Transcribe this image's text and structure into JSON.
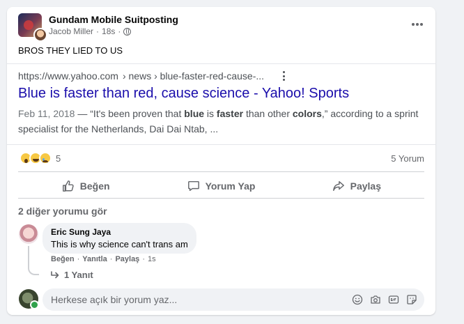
{
  "post": {
    "group_name": "Gundam Mobile Suitposting",
    "author": "Jacob Miller",
    "time": "18s",
    "text": "BROS THEY LIED TO US"
  },
  "link_preview": {
    "url_domain": "https://www.yahoo.com",
    "url_path": "› news › blue-faster-red-cause-...",
    "title": "Blue is faster than red, cause science - Yahoo! Sports",
    "date": "Feb 11, 2018",
    "snippet_parts": [
      "— “It's been proven that ",
      "blue",
      " is ",
      "faster",
      " than other ",
      "colors",
      ",” according to a sprint specialist for the Netherlands, Dai Dai Ntab, ..."
    ]
  },
  "reactions": {
    "icons": [
      "wow-emoji",
      "haha-emoji",
      "sad-emoji"
    ],
    "count": "5",
    "comments": "5 Yorum"
  },
  "actions": {
    "like": "Beğen",
    "comment": "Yorum Yap",
    "share": "Paylaş"
  },
  "comments": {
    "more": "2 diğer yorumu gör",
    "items": [
      {
        "name": "Eric Sung Jaya",
        "text": "This is why science can't trans am",
        "like": "Beğen",
        "reply": "Yanıtla",
        "share": "Paylaş",
        "time": "1s",
        "replies": "1 Yanıt"
      }
    ]
  },
  "composer": {
    "placeholder": "Herkese açık bir yorum yaz..."
  },
  "colors": {
    "link_title": "#1a0dab",
    "card_bg": "#ffffff",
    "page_bg": "#f0f2f5",
    "muted": "#65676b"
  }
}
